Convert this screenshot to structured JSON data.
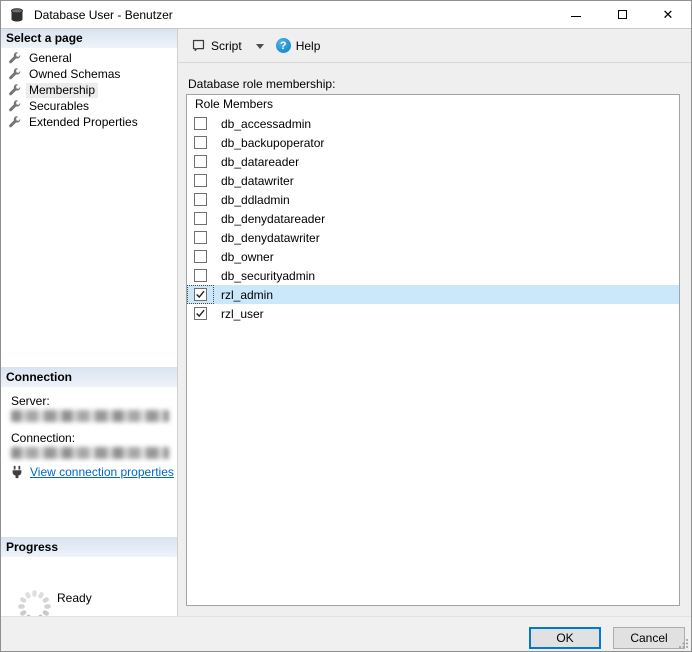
{
  "window": {
    "title": "Database User - Benutzer"
  },
  "icons": {
    "app": "database-cylinder",
    "minimize": "minimize-dash",
    "maximize": "maximize-box",
    "close": "✕",
    "page_item": "wrench",
    "script": "script-window",
    "script_caret": "▾",
    "help": "?",
    "connection_link": "plug",
    "progress": "spinner-ring",
    "resize": "resize-grip"
  },
  "sidebar": {
    "select_page_header": "Select a page",
    "pages": [
      {
        "label": "General",
        "selected": false
      },
      {
        "label": "Owned Schemas",
        "selected": false
      },
      {
        "label": "Membership",
        "selected": true
      },
      {
        "label": "Securables",
        "selected": false
      },
      {
        "label": "Extended Properties",
        "selected": false
      }
    ],
    "connection": {
      "header": "Connection",
      "server_label": "Server:",
      "server_value_redacted": true,
      "connection_label": "Connection:",
      "connection_value_redacted": true,
      "link_label": "View connection properties"
    },
    "progress": {
      "header": "Progress",
      "status": "Ready"
    }
  },
  "toolbar": {
    "script_label": "Script",
    "help_label": "Help"
  },
  "main": {
    "membership_label": "Database role membership:",
    "list_header": "Role Members",
    "roles": [
      {
        "name": "db_accessadmin",
        "checked": false,
        "selected": false
      },
      {
        "name": "db_backupoperator",
        "checked": false,
        "selected": false
      },
      {
        "name": "db_datareader",
        "checked": false,
        "selected": false
      },
      {
        "name": "db_datawriter",
        "checked": false,
        "selected": false
      },
      {
        "name": "db_ddladmin",
        "checked": false,
        "selected": false
      },
      {
        "name": "db_denydatareader",
        "checked": false,
        "selected": false
      },
      {
        "name": "db_denydatawriter",
        "checked": false,
        "selected": false
      },
      {
        "name": "db_owner",
        "checked": false,
        "selected": false
      },
      {
        "name": "db_securityadmin",
        "checked": false,
        "selected": false
      },
      {
        "name": "rzl_admin",
        "checked": true,
        "selected": true
      },
      {
        "name": "rzl_user",
        "checked": true,
        "selected": false
      }
    ]
  },
  "footer": {
    "ok_label": "OK",
    "cancel_label": "Cancel"
  },
  "colors": {
    "selection": "#cbe8fa",
    "accent": "#0078d7",
    "link": "#0066cc",
    "help_icon": "#1b8ed3",
    "header_gradient_top": "#d9e3f0",
    "header_gradient_bottom": "#eef3f9"
  }
}
